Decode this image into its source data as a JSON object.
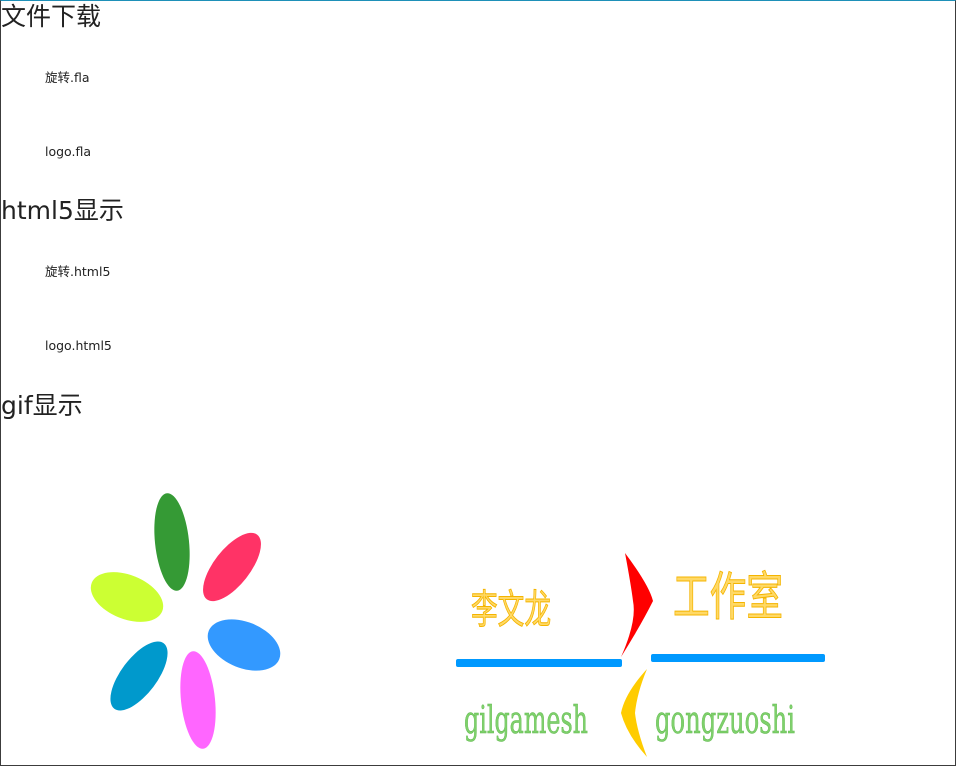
{
  "sections": {
    "download": {
      "heading": "文件下载",
      "links": [
        "旋转.fla",
        "logo.fla"
      ]
    },
    "html5": {
      "heading": "html5显示",
      "links": [
        "旋转.html5",
        "logo.html5"
      ]
    },
    "gif": {
      "heading": "gif显示"
    }
  },
  "logo": {
    "name_cn": "李文龙",
    "studio_cn": "工作室",
    "name_en": "gilgamesh",
    "studio_en": "gongzuoshi"
  },
  "colors": {
    "petals": [
      "#359a35",
      "#ff3366",
      "#3399ff",
      "#ff66ff",
      "#0099cc",
      "#ccff33"
    ],
    "logo_bar": "#0099ff",
    "logo_arrow_right": "#ff0000",
    "logo_arrow_left": "#ffcc00"
  },
  "icons": {
    "spin_gif": "flower-petals",
    "logo_gif": "studio-logo"
  }
}
